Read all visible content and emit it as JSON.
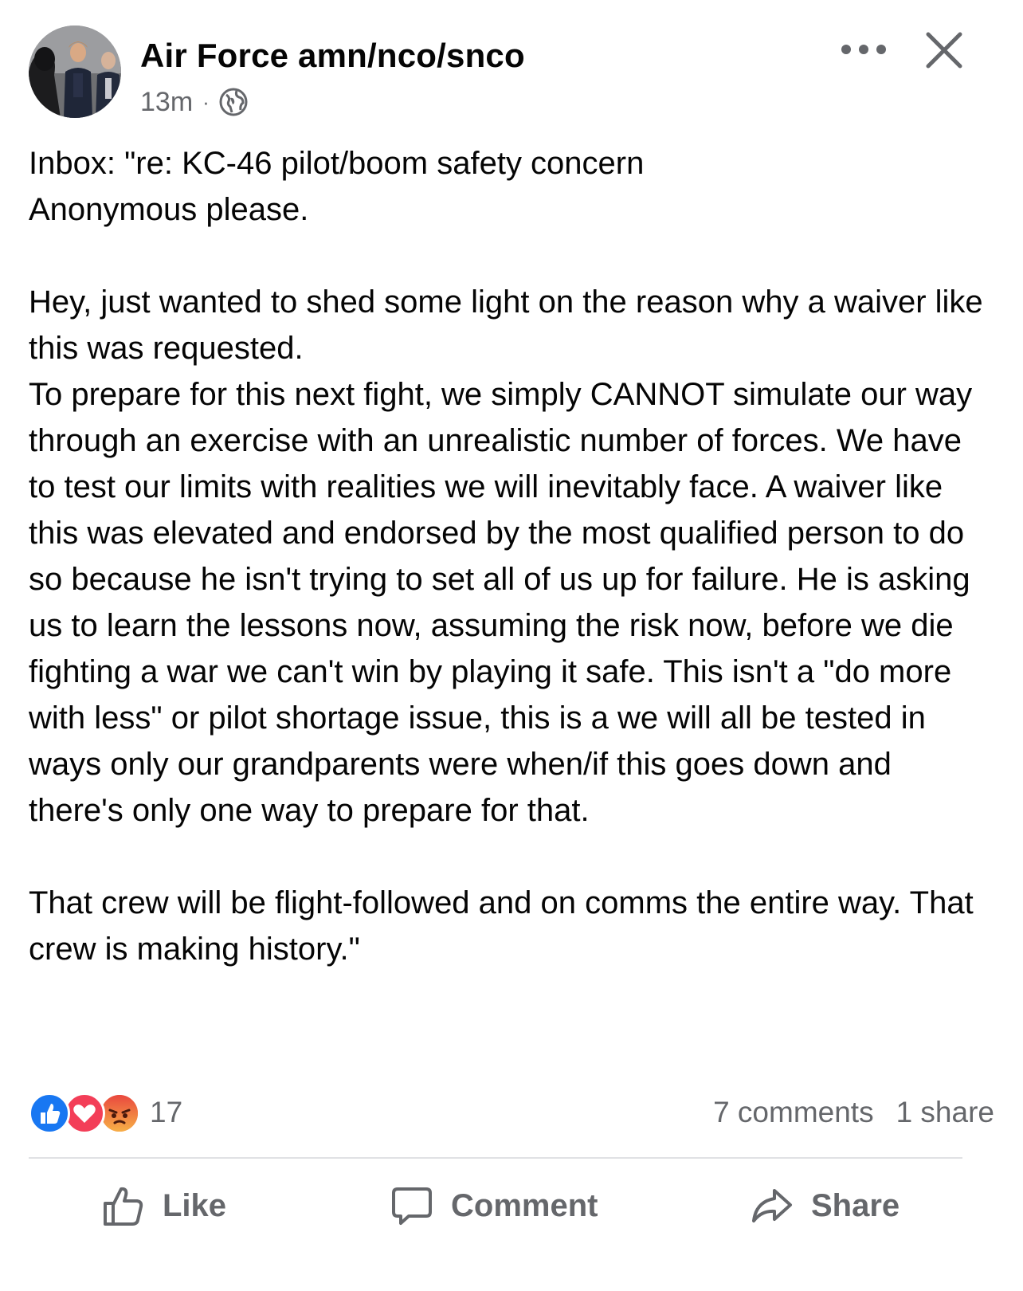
{
  "post": {
    "author": "Air Force amn/nco/snco",
    "timestamp": "13m",
    "separator": "·",
    "privacy_icon": "globe-icon",
    "body": {
      "p1_line1": "Inbox: \"re: KC-46 pilot/boom safety concern",
      "p1_line2": "Anonymous please.",
      "p2_line1": "Hey, just wanted to shed some light on the reason why a waiver like this was requested.",
      "p2_line2": "To prepare for this next fight, we simply CANNOT simulate our way through an exercise with an unrealistic number of forces. We have to test our limits with realities we will inevitably face. A waiver like this was elevated and endorsed by the most qualified person to do so because he isn't trying to set all of us up for failure. He is asking us to learn the lessons now, assuming the risk now, before we die fighting a war we can't win by playing it safe. This isn't a \"do more with less\" or pilot shortage issue, this is a we will all be tested in ways only our grandparents were when/if this goes down and there's only one way to prepare for that.",
      "p3": "That crew will be flight-followed and on comms the entire way. That crew is making history.\""
    }
  },
  "reactions": {
    "types": [
      "like-icon",
      "love-icon",
      "angry-icon"
    ],
    "count": "17",
    "comments": "7 comments",
    "shares": "1 share"
  },
  "actions": {
    "like_label": "Like",
    "comment_label": "Comment",
    "share_label": "Share"
  },
  "colors": {
    "text_primary": "#050505",
    "text_secondary": "#65676b",
    "like_blue": "#1877f2",
    "love_red": "#f33e58",
    "angry_orange": "#f7714c",
    "divider": "#e0e1e4"
  }
}
